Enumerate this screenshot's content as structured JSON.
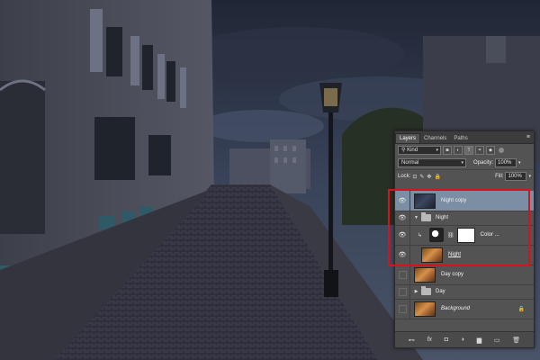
{
  "panel": {
    "tabs": [
      "Layers",
      "Channels",
      "Paths"
    ],
    "menu_icon": "≡",
    "filter": {
      "label": "Kind",
      "icon": "search-icon"
    },
    "filter_buttons": [
      "◙",
      "◐",
      "T",
      "⌗",
      "◆"
    ],
    "blend_mode": "Normal",
    "opacity_label": "Opacity:",
    "opacity_value": "100%",
    "lock_label": "Lock:",
    "lock_icons": [
      "⊡",
      "✎",
      "✥",
      "🔒"
    ],
    "fill_label": "Fill:",
    "fill_value": "100%"
  },
  "layers": [
    {
      "name": "Night copy",
      "type": "pixel",
      "thumb": "night",
      "visible": true,
      "selected": true
    },
    {
      "name": "Night",
      "type": "group",
      "expanded": true,
      "visible": true,
      "selected": false
    },
    {
      "name": "Color ...",
      "type": "adjustment",
      "visible": true,
      "selected": false
    },
    {
      "name": "Night",
      "type": "pixel",
      "thumb": "day",
      "visible": true,
      "selected": false,
      "underline": true
    },
    {
      "name": "Day copy",
      "type": "pixel",
      "thumb": "day",
      "visible": false,
      "selected": false
    },
    {
      "name": "Day",
      "type": "group",
      "expanded": false,
      "visible": false,
      "selected": false
    },
    {
      "name": "Background",
      "type": "pixel",
      "thumb": "day",
      "visible": false,
      "selected": false,
      "italic": true,
      "locked": true
    }
  ],
  "bottom_icons": [
    "⊷",
    "fx",
    "◘",
    "◑",
    "▆",
    "▭",
    "🗑"
  ],
  "colors": {
    "highlight": "#d8121d",
    "panel_bg": "#535353",
    "selected_layer": "#7b8ea3"
  }
}
